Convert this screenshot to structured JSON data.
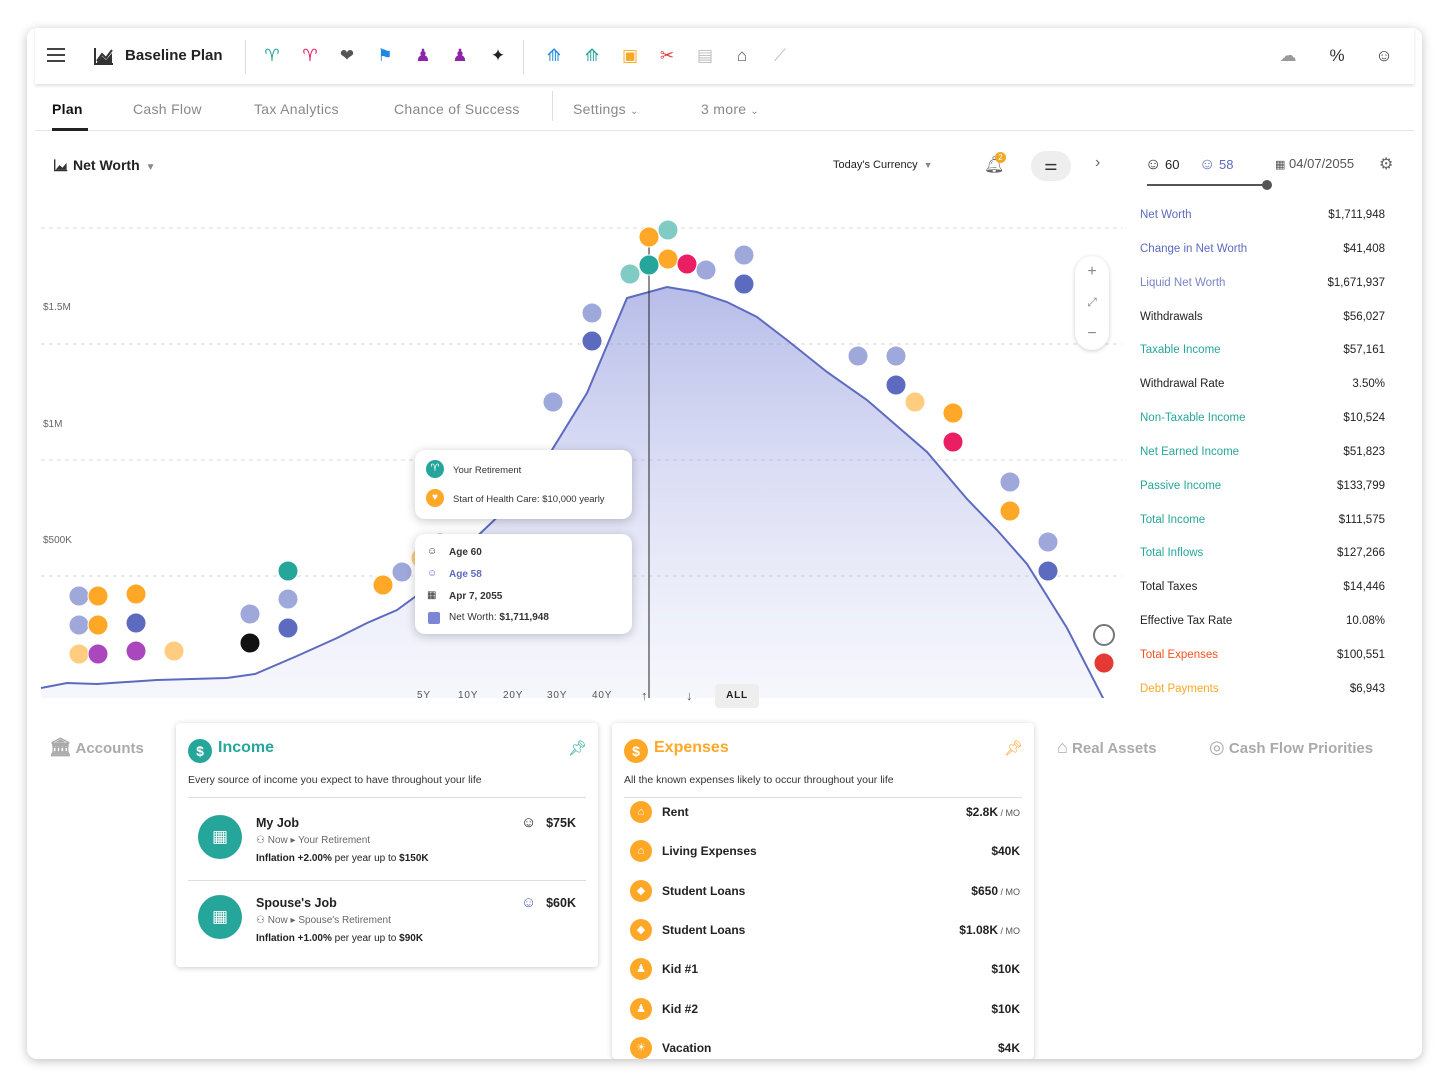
{
  "app": {
    "plan_title": "Baseline Plan"
  },
  "tabs": [
    {
      "label": "Plan"
    },
    {
      "label": "Cash Flow"
    },
    {
      "label": "Tax Analytics"
    },
    {
      "label": "Chance of Success"
    },
    {
      "label": "Settings"
    },
    {
      "label": "3 more"
    }
  ],
  "chart_header": {
    "metric": "Net Worth",
    "currency": "Today's Currency",
    "notification_count": "2"
  },
  "chart_data": {
    "type": "area",
    "title": "",
    "y_ticks": [
      "$1.5M",
      "$1M",
      "$500K"
    ],
    "ylim": [
      0,
      2000000
    ],
    "series": [
      {
        "name": "Net Worth",
        "color": "#6b76cc"
      }
    ],
    "marker_age": 60,
    "ranges": [
      "5Y",
      "10Y",
      "20Y",
      "30Y",
      "40Y",
      "ALL"
    ]
  },
  "tooltip_events": {
    "retirement": "Your Retirement",
    "health_care": "Start of Health Care: $10,000 yearly"
  },
  "tooltip_point": {
    "age1": "Age 60",
    "age2": "Age 58",
    "date": "Apr 7, 2055",
    "net_worth_label": "Net Worth: ",
    "net_worth_value": "$1,711,948"
  },
  "right_panel": {
    "age1": "60",
    "age2": "58",
    "date": "04/07/2055",
    "metrics": [
      {
        "label": "Net Worth",
        "value": "$1,711,948",
        "color": "#5b6bc0"
      },
      {
        "label": "Change in Net Worth",
        "value": "$41,408",
        "color": "#5b6bc0"
      },
      {
        "label": "Liquid Net Worth",
        "value": "$1,671,937",
        "color": "#7a84c9"
      },
      {
        "label": "Withdrawals",
        "value": "$56,027",
        "color": "#222222"
      },
      {
        "label": "Taxable Income",
        "value": "$57,161",
        "color": "#26a69a"
      },
      {
        "label": "Withdrawal Rate",
        "value": "3.50%",
        "color": "#222222"
      },
      {
        "label": "Non-Taxable Income",
        "value": "$10,524",
        "color": "#26a69a"
      },
      {
        "label": "Net Earned Income",
        "value": "$51,823",
        "color": "#26a69a"
      },
      {
        "label": "Passive Income",
        "value": "$133,799",
        "color": "#26a69a"
      },
      {
        "label": "Total Income",
        "value": "$111,575",
        "color": "#26a69a"
      },
      {
        "label": "Total Inflows",
        "value": "$127,266",
        "color": "#26a69a"
      },
      {
        "label": "Total Taxes",
        "value": "$14,446",
        "color": "#222222"
      },
      {
        "label": "Effective Tax Rate",
        "value": "10.08%",
        "color": "#222222"
      },
      {
        "label": "Total Expenses",
        "value": "$100,551",
        "color": "#f4511e"
      },
      {
        "label": "Debt Payments",
        "value": "$6,943",
        "color": "#f9a825"
      }
    ]
  },
  "bottom_tabs": {
    "accounts": "Accounts",
    "real_assets": "Real Assets",
    "cash_flow_priorities": "Cash Flow Priorities"
  },
  "income": {
    "title": "Income",
    "subtitle": "Every source of income you expect to have throughout your life",
    "items": [
      {
        "name": "My Job",
        "from": "Now",
        "to": "Your Retirement",
        "inflation_label": "Inflation",
        "inflation": "+2.00%",
        "inflation_rest": " per year up to ",
        "cap": "$150K",
        "amount": "$75K"
      },
      {
        "name": "Spouse's Job",
        "from": "Now",
        "to": "Spouse's Retirement",
        "inflation_label": "Inflation",
        "inflation": "+1.00%",
        "inflation_rest": " per year up to ",
        "cap": "$90K",
        "amount": "$60K"
      }
    ]
  },
  "expenses": {
    "title": "Expenses",
    "subtitle": "All the known expenses likely to occur throughout your life",
    "items": [
      {
        "name": "Rent",
        "amount": "$2.8K",
        "unit": " / MO"
      },
      {
        "name": "Living Expenses",
        "amount": "$40K",
        "unit": ""
      },
      {
        "name": "Student Loans",
        "amount": "$650",
        "unit": " / MO"
      },
      {
        "name": "Student Loans",
        "amount": "$1.08K",
        "unit": " / MO"
      },
      {
        "name": "Kid #1",
        "amount": "$10K",
        "unit": ""
      },
      {
        "name": "Kid #2",
        "amount": "$10K",
        "unit": ""
      },
      {
        "name": "Vacation",
        "amount": "$4K",
        "unit": ""
      }
    ]
  }
}
